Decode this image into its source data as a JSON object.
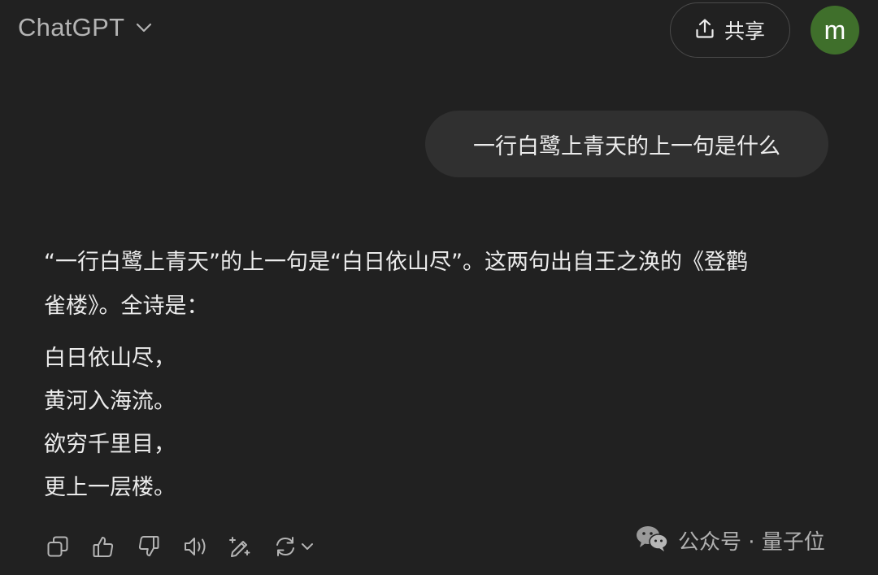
{
  "header": {
    "model_name": "ChatGPT",
    "share_label": "共享",
    "avatar_initial": "m"
  },
  "conversation": {
    "user_message": "一行白鹭上青天的上一句是什么",
    "assistant": {
      "intro_line1": "“一行白鹭上青天”的上一句是“白日依山尽”。这两句出自王之涣的《登鹳",
      "intro_line2": "雀楼》。全诗是：",
      "poem": [
        "白日依山尽，",
        "黄河入海流。",
        "欲穷千里目，",
        "更上一层楼。"
      ]
    }
  },
  "actions": {
    "icons": [
      "copy-icon",
      "thumbs-up-icon",
      "thumbs-down-icon",
      "read-aloud-icon",
      "edit-sparkle-icon",
      "regenerate-icon"
    ]
  },
  "watermark": {
    "text": "公众号 · 量子位"
  },
  "colors": {
    "background": "#212121",
    "bubble": "#303030",
    "avatar": "#3f6f2b",
    "text": "#ececec",
    "muted": "#b4b4b4"
  }
}
